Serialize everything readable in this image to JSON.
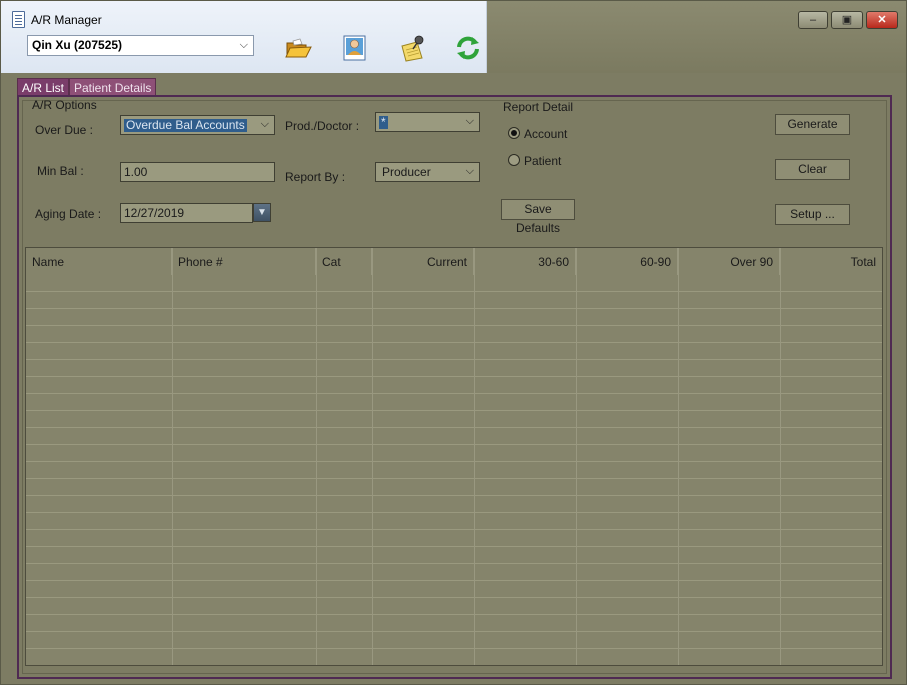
{
  "window": {
    "title": "A/R Manager"
  },
  "toolbar": {
    "patient_selected": "Qin Xu (207525)",
    "tools": [
      "folder-open-icon",
      "patient-profile-icon",
      "note-pin-icon",
      "refresh-icon"
    ]
  },
  "tabs": [
    {
      "label": "A/R List",
      "active": true
    },
    {
      "label": "Patient Details",
      "active": false
    }
  ],
  "ar_options": {
    "group_label": "A/R Options",
    "over_due_label": "Over Due :",
    "over_due_value": "Overdue Bal Accounts",
    "min_bal_label": "Min Bal :",
    "min_bal_value": "1.00",
    "aging_date_label": "Aging Date :",
    "aging_date_value": "12/27/2019",
    "prod_doctor_label": "Prod./Doctor :",
    "prod_doctor_value": "*",
    "report_by_label": "Report By :",
    "report_by_value": "Producer"
  },
  "report_detail": {
    "group_label": "Report Detail",
    "options": [
      {
        "label": "Account",
        "selected": true
      },
      {
        "label": "Patient",
        "selected": false
      }
    ]
  },
  "buttons": {
    "save_defaults": "Save Defaults",
    "generate": "Generate",
    "clear": "Clear",
    "setup": "Setup ..."
  },
  "grid": {
    "columns": [
      "Name",
      "Phone #",
      "Cat",
      "Current",
      "30-60",
      "60-90",
      "Over 90",
      "Total"
    ],
    "rows": []
  },
  "colors": {
    "background": "#7d7c63",
    "tab_active": "#7a3d6a",
    "panel_border": "#4f2a52",
    "selection": "#2f5d8c"
  }
}
